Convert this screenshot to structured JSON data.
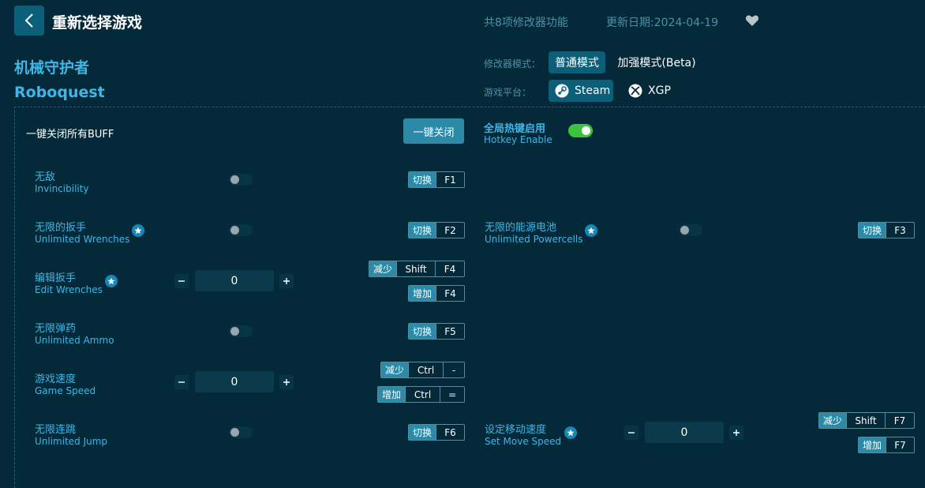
{
  "header": {
    "back_icon": "chevron-left-icon",
    "title": "重新选择游戏",
    "feature_count": "共8项修改器功能",
    "update_date": "更新日期:2024-04-19",
    "favorite_icon": "heart-icon"
  },
  "game": {
    "name_cn": "机械守护者",
    "name_en": "Roboquest"
  },
  "mode": {
    "label": "修改器模式：",
    "options": [
      "普通模式",
      "加强模式(Beta)"
    ],
    "selected": "普通模式"
  },
  "platform": {
    "label": "游戏平台：",
    "options": [
      {
        "name": "Steam",
        "icon": "steam-icon"
      },
      {
        "name": "XGP",
        "icon": "xbox-icon"
      }
    ],
    "selected": "Steam"
  },
  "global": {
    "close_all_label": "一键关闭所有BUFF",
    "close_all_button": "一键关闭",
    "hotkey_title": "全局热键启用",
    "hotkey_sub": "Hotkey Enable",
    "hotkey_enabled": true
  },
  "options": [
    {
      "cn": "无敌",
      "en": "Invincibility",
      "type": "toggle",
      "keys": [
        {
          "action": "切换",
          "keys": [
            "F1"
          ]
        }
      ]
    },
    {
      "cn": "无限的扳手",
      "en": "Unlimited Wrenches",
      "type": "toggle",
      "starred": true,
      "keys": [
        {
          "action": "切换",
          "keys": [
            "F2"
          ]
        }
      ]
    },
    {
      "cn": "无限的能源电池",
      "en": "Unlimited Powercells",
      "type": "toggle",
      "starred": true,
      "keys": [
        {
          "action": "切换",
          "keys": [
            "F3"
          ]
        }
      ]
    },
    {
      "cn": "编辑扳手",
      "en": "Edit Wrenches",
      "type": "number",
      "value": "0",
      "starred": true,
      "keys": [
        {
          "action": "减少",
          "keys": [
            "Shift",
            "F4"
          ]
        },
        {
          "action": "增加",
          "keys": [
            "F4"
          ]
        }
      ]
    },
    {
      "cn": "无限弹药",
      "en": "Unlimited Ammo",
      "type": "toggle",
      "keys": [
        {
          "action": "切换",
          "keys": [
            "F5"
          ]
        }
      ]
    },
    {
      "cn": "游戏速度",
      "en": "Game Speed",
      "type": "number",
      "value": "0",
      "keys": [
        {
          "action": "减少",
          "keys": [
            "Ctrl",
            "-"
          ]
        },
        {
          "action": "增加",
          "keys": [
            "Ctrl",
            "="
          ]
        }
      ]
    },
    {
      "cn": "无限连跳",
      "en": "Unlimited Jump",
      "type": "toggle",
      "keys": [
        {
          "action": "切换",
          "keys": [
            "F6"
          ]
        }
      ]
    },
    {
      "cn": "设定移动速度",
      "en": "Set Move Speed",
      "type": "number",
      "value": "0",
      "starred": true,
      "keys": [
        {
          "action": "减少",
          "keys": [
            "Shift",
            "F7"
          ]
        },
        {
          "action": "增加",
          "keys": [
            "F7"
          ]
        }
      ]
    }
  ],
  "colors": {
    "background": "#042a39",
    "accent": "#3fb6e6",
    "button": "#0b5f78",
    "toggle_on": "#3cc23c"
  }
}
